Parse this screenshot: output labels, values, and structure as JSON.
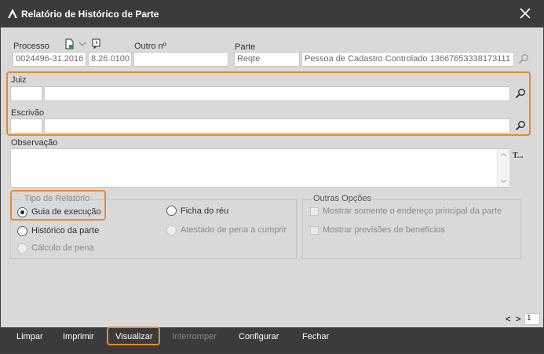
{
  "window": {
    "title": "Relatório de Histórico de Parte"
  },
  "labels": {
    "processo": "Processo",
    "outro_numero": "Outro nº",
    "parte": "Parte",
    "juiz": "Juiz",
    "escrivao": "Escrivão",
    "observacao": "Observação",
    "text_tool": "T..."
  },
  "fields": {
    "processo_numero": "0024496-31.2016",
    "processo_sufixo": "8.26.0100",
    "outro_numero": "",
    "parte_tipo": "Reqte",
    "parte_nome": "Pessoa de Cadastro Controlado 13667653338173111",
    "juiz_codigo": "",
    "juiz_nome": "",
    "escrivao_codigo": "",
    "escrivao_nome": "",
    "observacao": ""
  },
  "tipo_relatorio": {
    "legend": "Tipo de Relatório",
    "options": [
      {
        "label": "Guia de execução",
        "selected": true,
        "enabled": true
      },
      {
        "label": "Ficha do réu",
        "selected": false,
        "enabled": true
      },
      {
        "label": "Histórico da parte",
        "selected": false,
        "enabled": true
      },
      {
        "label": "Atestado de pena a cumprir",
        "selected": false,
        "enabled": false
      },
      {
        "label": "Cálculo de pena",
        "selected": false,
        "enabled": false
      }
    ]
  },
  "outras_opcoes": {
    "legend": "Outras Opções",
    "options": [
      {
        "label": "Mostrar somente o endereço principal da parte",
        "checked": false,
        "enabled": false
      },
      {
        "label": "Mostrar previsões de benefícios",
        "checked": false,
        "enabled": false
      }
    ]
  },
  "pager": {
    "prev": "<",
    "next": ">",
    "page": "1"
  },
  "toolbar": {
    "buttons": [
      {
        "label": "Limpar",
        "enabled": true
      },
      {
        "label": "Imprimir",
        "enabled": true
      },
      {
        "label": "Visualizar",
        "enabled": true
      },
      {
        "label": "Interromper",
        "enabled": false
      },
      {
        "label": "Configurar",
        "enabled": true
      },
      {
        "label": "Fechar",
        "enabled": true
      }
    ]
  },
  "colors": {
    "titlebar": "#3b3b3b",
    "body": "#d9d9d9",
    "highlight": "#e88a2e"
  },
  "icons": [
    "app-icon",
    "close-icon",
    "document-icon",
    "chevron-down-icon",
    "note-icon",
    "search-icon",
    "text-format-icon"
  ]
}
